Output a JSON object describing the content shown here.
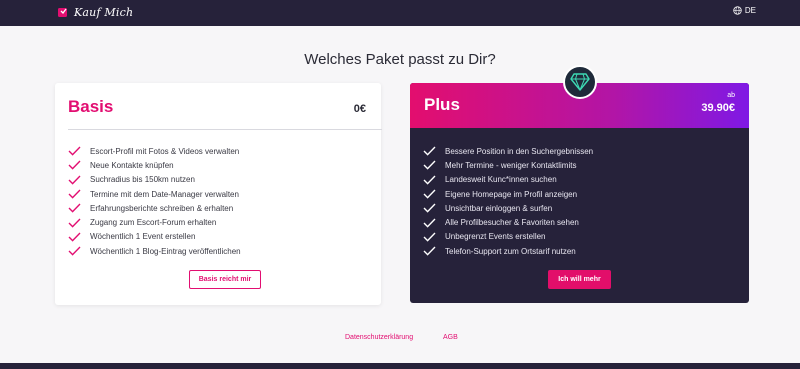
{
  "header": {
    "logo_text": "Kauf Mich",
    "language": "DE",
    "icons": {
      "logo": "logo-mark-icon",
      "language": "globe-icon"
    }
  },
  "headline": "Welches Paket passt zu Dir?",
  "basis": {
    "title": "Basis",
    "price": "0€",
    "features": [
      "Escort-Profil mit Fotos & Videos verwalten",
      "Neue Kontakte knüpfen",
      "Suchradius bis 150km nutzen",
      "Termine mit dem Date-Manager verwalten",
      "Erfahrungsberichte schreiben & erhalten",
      "Zugang zum Escort-Forum erhalten",
      "Wöchentlich 1 Event erstellen",
      "Wöchentlich 1 Blog-Eintrag veröffentlichen"
    ],
    "button": "Basis reicht mir"
  },
  "plus": {
    "title": "Plus",
    "price_prefix": "ab",
    "price": "39.90€",
    "badge_icon": "diamond-icon",
    "features": [
      "Bessere Position in den Suchergebnissen",
      "Mehr Termine - weniger Kontaktlimits",
      "Landesweit Kunc*innen suchen",
      "Eigene Homepage im Profil anzeigen",
      "Unsichtbar einloggen & surfen",
      "Alle Profilbesucher & Favoriten sehen",
      "Unbegrenzt Events erstellen",
      "Telefon-Support zum Ortstarif nutzen"
    ],
    "button": "Ich will mehr"
  },
  "footer": {
    "privacy": "Datenschutzerklärung",
    "terms": "AGB"
  },
  "colors": {
    "accent": "#e20e71",
    "dark": "#26223a",
    "gradient_start": "#e30e6e",
    "gradient_end": "#7f19e5",
    "gem": "#3ddab4"
  }
}
